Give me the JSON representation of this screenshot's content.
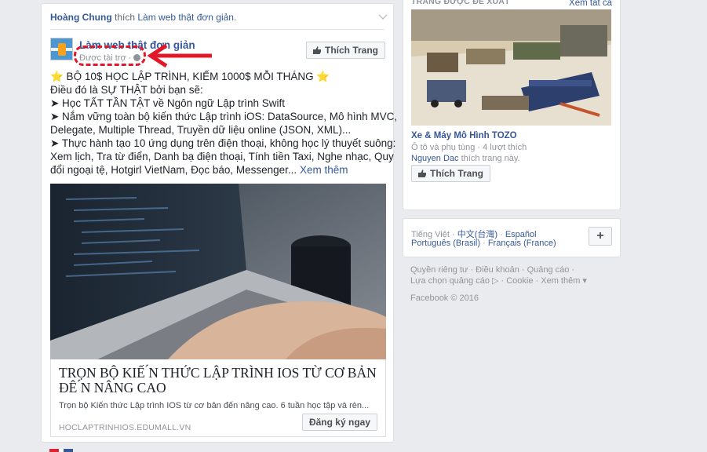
{
  "story": {
    "actor": "Hoàng Chung",
    "verb": " thích ",
    "page_liked": "Làm web thật đơn giản",
    "trailing": "."
  },
  "post": {
    "page_name": "Làm web thật đơn giản",
    "sponsored": "Được tài trợ ·",
    "like_button": "Thích Trang",
    "lines": [
      "⭐ BỘ 10$ HỌC LẬP TRÌNH, KIẾM 1000$ MỖI THÁNG ⭐",
      "Điều đó là SỰ THẬT bởi bạn sẽ:",
      "➤ Học TẤT TẦN TẬT về Ngôn ngữ Lập trình Swift",
      "➤ Nắm vững toàn bộ kiến thức Lập trình iOS: DataSource, Mô hình MVC,",
      "Delegate, Multiple Thread, Truyền dữ liệu online (JSON, XML)...",
      "➤ Thực hành tạo 10 ứng dụng trên điện thoại, không học lý thuyết suông:",
      "Xem lịch, Tra từ điển, Danh bạ điện thoại, Tính tiền Taxi, Nghe nhạc, Quy",
      "đổi ngoại tệ, Hotgirl VietNam, Đọc báo, Messenger..."
    ],
    "see_more": "Xem thêm",
    "link": {
      "title": "TRỌN BỘ KIẾ ́N THỨC LẬP TRÌNH IOS TỪ CƠ BẢN ĐÊ ́N NÂNG CAO",
      "description": "Trọn bộ Kiến thức Lập trình IOS từ cơ bản đến nâng cao. 6 tuần học tập và rèn...",
      "domain": "HOCLAPTRINHIOS.EDUMALL.VN",
      "cta": "Đăng ký ngay"
    }
  },
  "sidebar": {
    "rec_title": "TRANG ĐƯỢC ĐỀ XUẤT",
    "see_all": "Xem tất cả",
    "rec_page_name": "Xe & Máy Mô Hình TOZO",
    "rec_meta": "Ô tô và phụ tùng · 4 lượt thích",
    "rec_friend": "Nguyen Dac",
    "rec_friend_suffix": " thích trang này.",
    "rec_like_button": "Thích Trang",
    "languages": {
      "current": "Tiếng Việt ·",
      "chinese": "中文(台灣)",
      "spanish": "Español",
      "portuguese": "Português (Brasil)",
      "french": "Français (France)",
      "dot": " · ",
      "add": "+"
    },
    "footer": {
      "row1": "Quyền riêng tư · Điều khoản · Quảng cáo ·",
      "row2": "Lựa chọn quảng cáo ▷ · Cookie · Xem thêm ▾",
      "copyright": "Facebook © 2016"
    }
  },
  "colors": {
    "link": "#365899",
    "annotation": "#e3172a",
    "background": "#e9ebee"
  }
}
